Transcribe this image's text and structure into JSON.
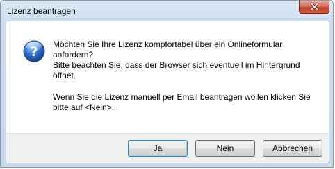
{
  "window": {
    "title": "Lizenz beantragen"
  },
  "titlebar": {
    "close_icon": "close-icon"
  },
  "dialog": {
    "icon": "question-icon",
    "lines_1": [
      "Möchten Sie Ihre Lizenz kompfortabel über ein Onlineformular",
      "anfordern?",
      "Bitte beachten Sie, dass der Browser sich eventuell im Hintergrund",
      "öffnet."
    ],
    "lines_2": [
      "Wenn Sie die Lizenz manuell per Email beantragen wollen klicken Sie",
      "bitte auf <Nein>."
    ]
  },
  "buttons": {
    "yes_label": "Ja",
    "no_label": "Nein",
    "cancel_label": "Abbrechen"
  },
  "colors": {
    "close_button": "#c2412a",
    "icon_blue": "#2f6fd0",
    "title_gradient_top": "#dbe8f5"
  }
}
